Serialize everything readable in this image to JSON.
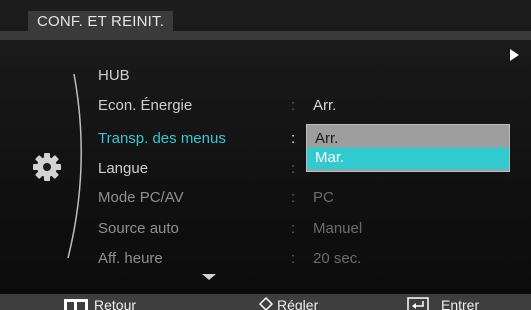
{
  "title": "CONF. ET REINIT.",
  "menu": [
    {
      "label": "HUB",
      "value": ""
    },
    {
      "label": "Econ. Énergie",
      "value": "Arr."
    },
    {
      "label": "Transp. des menus",
      "value": ""
    },
    {
      "label": "Langue",
      "value": ""
    },
    {
      "label": "Mode PC/AV",
      "value": "PC"
    },
    {
      "label": "Source auto",
      "value": "Manuel"
    },
    {
      "label": "Aff. heure",
      "value": "20 sec."
    }
  ],
  "dropdown": {
    "options": [
      "Arr.",
      "Mar."
    ],
    "selected": "Mar."
  },
  "footer": {
    "back_label": "Retour",
    "adjust_label": "Régler",
    "enter_label": "Entrer"
  },
  "colors": {
    "accent": "#33c9d1",
    "highlight_text": "#36c6d6",
    "dropdown_bg": "#9e9e9e",
    "bar": "#3a3a3a"
  },
  "icons": {
    "category": "gear-icon",
    "scroll_right": "triangle-right-icon",
    "scroll_down": "triangle-down-icon",
    "back": "menu-grid-icon",
    "adjust": "diamond-arrows-icon",
    "enter": "enter-icon"
  }
}
